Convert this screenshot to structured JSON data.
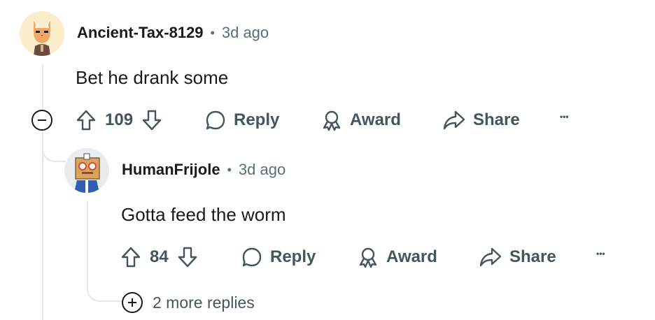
{
  "comments": [
    {
      "author": "Ancient-Tax-8129",
      "separator": "•",
      "time": "3d ago",
      "body": "Bet he drank some",
      "score": "109",
      "reply_label": "Reply",
      "award_label": "Award",
      "share_label": "Share",
      "more_label": "•••"
    },
    {
      "author": "HumanFrijole",
      "separator": "•",
      "time": "3d ago",
      "body": "Gotta feed the worm",
      "score": "84",
      "reply_label": "Reply",
      "award_label": "Award",
      "share_label": "Share",
      "more_label": "•••",
      "more_replies_label": "2 more replies"
    }
  ],
  "colors": {
    "text_primary": "#1a1a1b",
    "text_secondary": "#576f76",
    "action_text": "#45555c",
    "thread_line": "#e3e6e8"
  }
}
